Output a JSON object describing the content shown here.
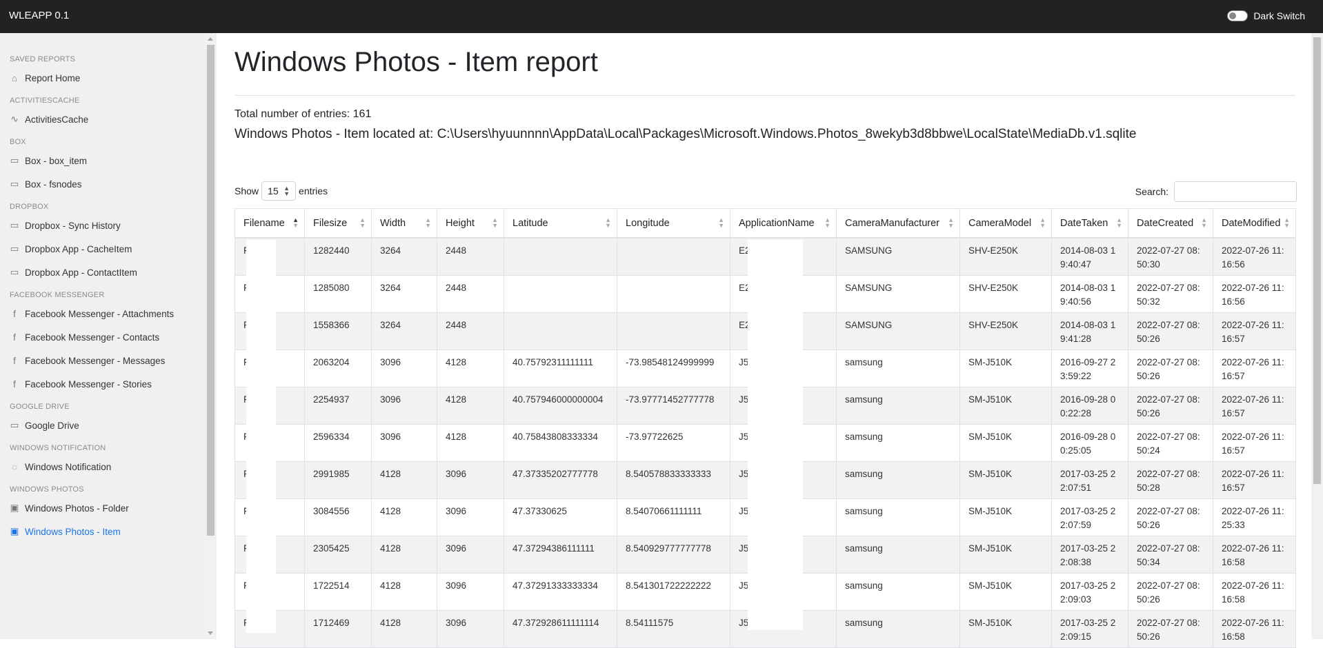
{
  "app": {
    "title": "WLEAPP 0.1",
    "dark_switch_label": "Dark Switch"
  },
  "sidebar": {
    "sections": [
      {
        "head": "SAVED REPORTS",
        "items": [
          {
            "label": "Report Home",
            "icon": "home-icon"
          }
        ]
      },
      {
        "head": "ACTIVITIESCACHE",
        "items": [
          {
            "label": "ActivitiesCache",
            "icon": "activity-icon"
          }
        ]
      },
      {
        "head": "BOX",
        "items": [
          {
            "label": "Box - box_item",
            "icon": "hard-drive-icon"
          },
          {
            "label": "Box - fsnodes",
            "icon": "hard-drive-icon"
          }
        ]
      },
      {
        "head": "DROPBOX",
        "items": [
          {
            "label": "Dropbox - Sync History",
            "icon": "hard-drive-icon"
          },
          {
            "label": "Dropbox App - CacheItem",
            "icon": "hard-drive-icon"
          },
          {
            "label": "Dropbox App - ContactItem",
            "icon": "hard-drive-icon"
          }
        ]
      },
      {
        "head": "FACEBOOK MESSENGER",
        "items": [
          {
            "label": "Facebook Messenger - Attachments",
            "icon": "facebook-icon"
          },
          {
            "label": "Facebook Messenger - Contacts",
            "icon": "facebook-icon"
          },
          {
            "label": "Facebook Messenger - Messages",
            "icon": "facebook-icon"
          },
          {
            "label": "Facebook Messenger - Stories",
            "icon": "facebook-icon"
          }
        ]
      },
      {
        "head": "GOOGLE DRIVE",
        "items": [
          {
            "label": "Google Drive",
            "icon": "hard-drive-icon"
          }
        ]
      },
      {
        "head": "WINDOWS NOTIFICATION",
        "items": [
          {
            "label": "Windows Notification",
            "icon": "bell-icon"
          }
        ]
      },
      {
        "head": "WINDOWS PHOTOS",
        "items": [
          {
            "label": "Windows Photos - Folder",
            "icon": "image-icon"
          },
          {
            "label": "Windows Photos - Item",
            "icon": "image-icon",
            "active": true
          }
        ]
      }
    ]
  },
  "main": {
    "title": "Windows Photos - Item report",
    "total": "Total number of entries: 161",
    "location": "Windows Photos - Item located at: C:\\Users\\hyuunnnn\\AppData\\Local\\Packages\\Microsoft.Windows.Photos_8wekyb3d8bbwe\\LocalState\\MediaDb.v1.sqlite",
    "show_label": "Show",
    "entries_value": "15",
    "entries_label": "entries",
    "search_label": "Search:"
  },
  "table": {
    "columns": [
      "Filename",
      "Filesize",
      "Width",
      "Height",
      "Latitude",
      "Longitude",
      "ApplicationName",
      "CameraManufacturer",
      "CameraModel",
      "DateTaken",
      "DateCreated",
      "DateModified"
    ],
    "rows": [
      [
        "F .jpg",
        "1282440",
        "3264",
        "2448",
        "",
        "",
        "E2 3",
        "SAMSUNG",
        "SHV-E250K",
        "2014-08-03 19:40:47",
        "2022-07-27 08:50:30",
        "2022-07-26 11:16:56"
      ],
      [
        "F .jpg",
        "1285080",
        "3264",
        "2448",
        "",
        "",
        "E2 3",
        "SAMSUNG",
        "SHV-E250K",
        "2014-08-03 19:40:56",
        "2022-07-27 08:50:32",
        "2022-07-26 11:16:56"
      ],
      [
        "F .jpg",
        "1558366",
        "3264",
        "2448",
        "",
        "",
        "E2 3",
        "SAMSUNG",
        "SHV-E250K",
        "2014-08-03 19:41:28",
        "2022-07-27 08:50:26",
        "2022-07-26 11:16:57"
      ],
      [
        "F .jpg",
        "2063204",
        "3096",
        "4128",
        "40.75792311111111",
        "-73.98548124999999",
        "J5 G2",
        "samsung",
        "SM-J510K",
        "2016-09-27 23:59:22",
        "2022-07-27 08:50:26",
        "2022-07-26 11:16:57"
      ],
      [
        "F .jpg",
        "2254937",
        "3096",
        "4128",
        "40.757946000000004",
        "-73.97771452777778",
        "J5 G2",
        "samsung",
        "SM-J510K",
        "2016-09-28 00:22:28",
        "2022-07-27 08:50:26",
        "2022-07-26 11:16:57"
      ],
      [
        "F .jpg",
        "2596334",
        "3096",
        "4128",
        "40.75843808333334",
        "-73.97722625",
        "J5 G2",
        "samsung",
        "SM-J510K",
        "2016-09-28 00:25:05",
        "2022-07-27 08:50:24",
        "2022-07-26 11:16:57"
      ],
      [
        "F .jpg",
        "2991985",
        "4128",
        "3096",
        "47.37335202777778",
        "8.540578833333333",
        "J5 K2",
        "samsung",
        "SM-J510K",
        "2017-03-25 22:07:51",
        "2022-07-27 08:50:28",
        "2022-07-26 11:16:57"
      ],
      [
        "F .jpg",
        "3084556",
        "4128",
        "3096",
        "47.37330625",
        "8.54070661111111",
        "J5 K2",
        "samsung",
        "SM-J510K",
        "2017-03-25 22:07:59",
        "2022-07-27 08:50:26",
        "2022-07-26 11:25:33"
      ],
      [
        "F .jpg",
        "2305425",
        "4128",
        "3096",
        "47.37294386111111",
        "8.540929777777778",
        "J5 K2",
        "samsung",
        "SM-J510K",
        "2017-03-25 22:08:38",
        "2022-07-27 08:50:34",
        "2022-07-26 11:16:58"
      ],
      [
        "F .jpg",
        "1722514",
        "4128",
        "3096",
        "47.37291333333334",
        "8.541301722222222",
        "J5 K2",
        "samsung",
        "SM-J510K",
        "2017-03-25 22:09:03",
        "2022-07-27 08:50:26",
        "2022-07-26 11:16:58"
      ],
      [
        "F .jpg",
        "1712469",
        "4128",
        "3096",
        "47.372928611111114",
        "8.54111575",
        "J5 K2",
        "samsung",
        "SM-J510K",
        "2017-03-25 22:09:15",
        "2022-07-27 08:50:26",
        "2022-07-26 11:16:58"
      ]
    ]
  },
  "colors": {
    "navbar": "#222222",
    "sidebar": "#f0f0f0",
    "active_link": "#1a73e8",
    "striped_row": "#f2f2f2"
  }
}
